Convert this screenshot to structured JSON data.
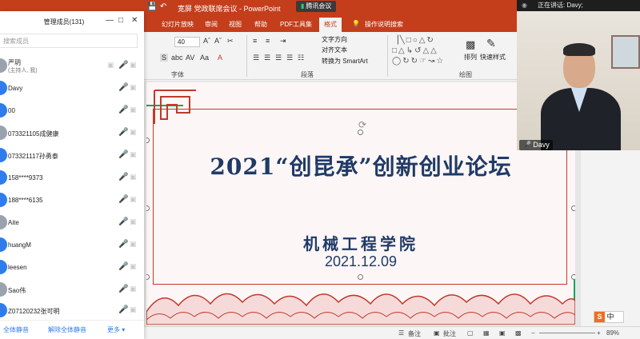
{
  "ppt": {
    "title": "宽屏 党政联席会议  -  PowerPoint",
    "tabs": [
      "幻灯片放映",
      "审阅",
      "视图",
      "帮助",
      "PDF工具集",
      "格式"
    ],
    "active_tab": "格式",
    "tell_me": "操作说明搜索",
    "font_size": "40",
    "groups": {
      "font": "字体",
      "paragraph": "段落",
      "drawing": "绘图"
    },
    "text_direction": "文字方向",
    "align_text": "对齐文本",
    "smartart": "转换为 SmartArt",
    "arrange": "排列",
    "quick_styles": "快速样式"
  },
  "meeting": {
    "app_pill": "腾讯会议",
    "speaking_label": "正在讲话: Davy;",
    "video_name": "Davy"
  },
  "slide": {
    "title": "2021“创昆承”创新创业论坛",
    "college": "机械工程学院",
    "date": "2021.12.09"
  },
  "statusbar": {
    "notes": "备注",
    "comments": "批注",
    "zoom": "89%"
  },
  "members": {
    "title": "管理成员(131)",
    "search_placeholder": "搜索成员",
    "list": [
      {
        "name": "严玥",
        "role": "(主持人, 我)",
        "speaking": false
      },
      {
        "name": "Davy",
        "role": "",
        "speaking": true
      },
      {
        "name": "00",
        "role": "",
        "speaking": false
      },
      {
        "name": "073321105成健康",
        "role": "",
        "speaking": false
      },
      {
        "name": "073321117孙勇泰",
        "role": "",
        "speaking": false
      },
      {
        "name": "158****9373",
        "role": "",
        "speaking": false
      },
      {
        "name": "188****6135",
        "role": "",
        "speaking": false
      },
      {
        "name": "Aite",
        "role": "",
        "speaking": false
      },
      {
        "name": "huangM",
        "role": "",
        "speaking": false
      },
      {
        "name": "leesen",
        "role": "",
        "speaking": false
      },
      {
        "name": "Sao伟",
        "role": "",
        "speaking": false
      },
      {
        "name": "Z07120232张可明",
        "role": "",
        "speaking": false
      }
    ],
    "footer": {
      "mute_all": "全体静音",
      "unmute_all": "解除全体静音",
      "more": "更多 ▾"
    }
  },
  "ime": {
    "logo": "S",
    "mode": "中"
  },
  "colors": {
    "ppt_red": "#c43e1c",
    "slide_text": "#1f3a66",
    "frame_red": "#c0392b",
    "accent_blue": "#2f7ded",
    "speaking_green": "#2ecc71"
  }
}
